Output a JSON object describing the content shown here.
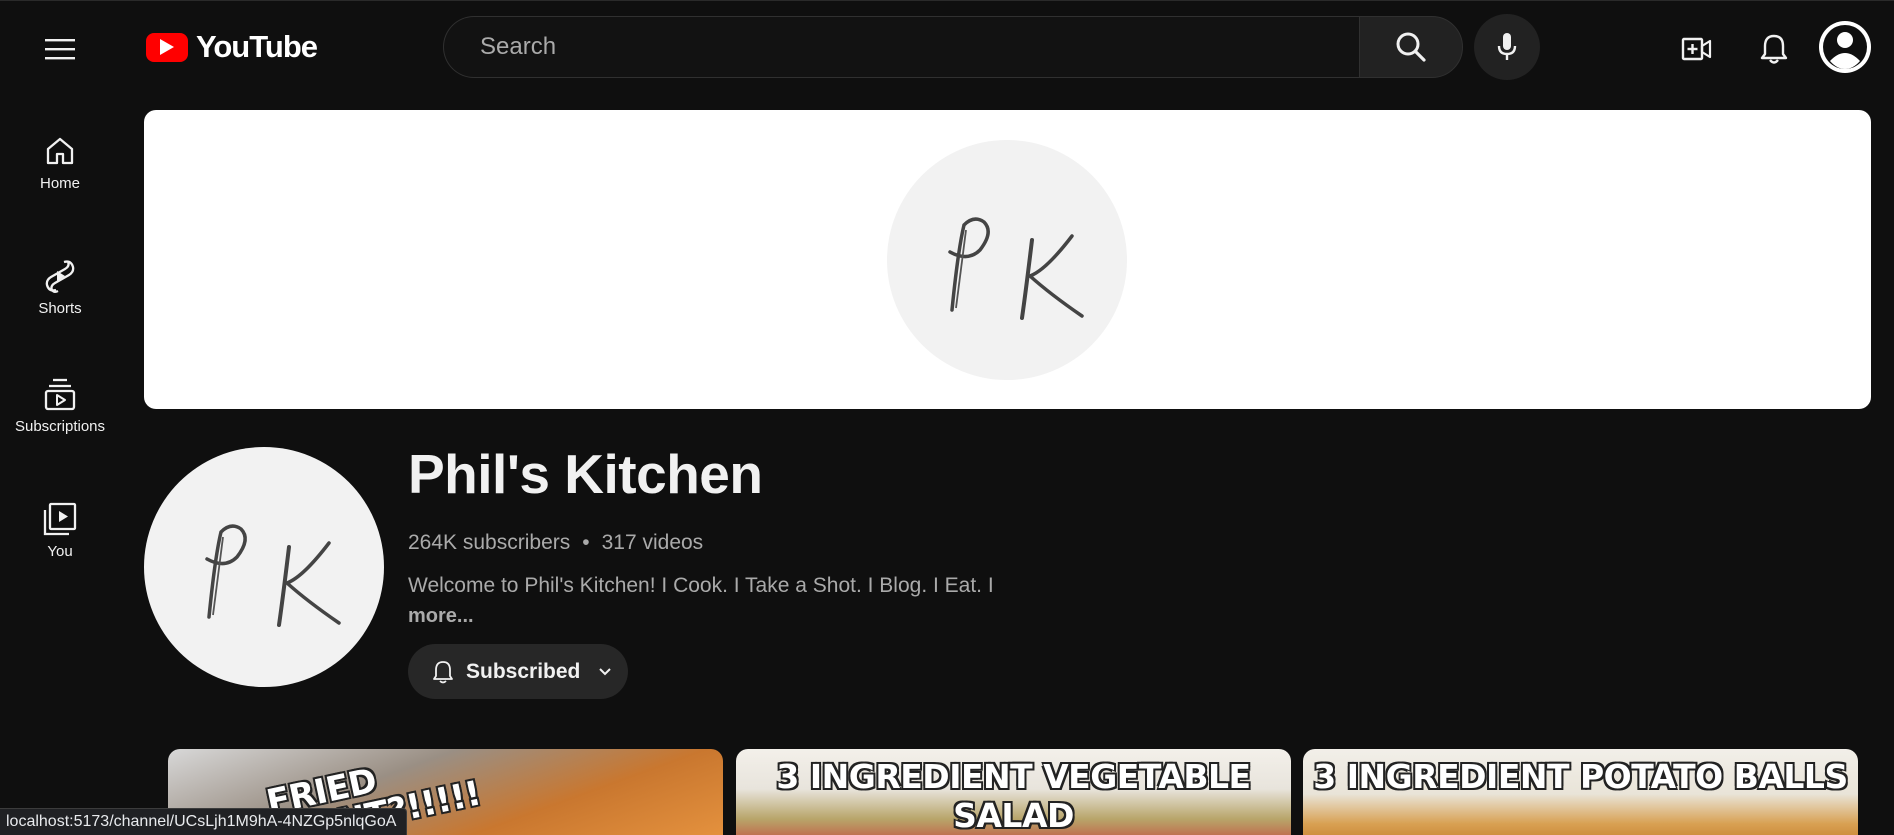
{
  "header": {
    "logo_text": "YouTube",
    "search_placeholder": "Search"
  },
  "sidebar": {
    "items": [
      {
        "label": "Home",
        "icon": "home-icon"
      },
      {
        "label": "Shorts",
        "icon": "shorts-icon"
      },
      {
        "label": "Subscriptions",
        "icon": "subscriptions-icon"
      },
      {
        "label": "You",
        "icon": "you-icon"
      }
    ]
  },
  "channel": {
    "name": "Phil's Kitchen",
    "subscribers": "264K subscribers",
    "separator": "•",
    "videos": "317 videos",
    "description": "Welcome to Phil's Kitchen! I Cook. I Take a Shot. I Blog. I Eat. I",
    "more_label": "more...",
    "subscribe_label": "Subscribed",
    "logo_monogram": "PK"
  },
  "videos": [
    {
      "thumb_text": "FRIED GIANT?!!!!!"
    },
    {
      "thumb_text": "3 INGREDIENT VEGETABLE SALAD"
    },
    {
      "thumb_text": "3 INGREDIENT POTATO BALLS"
    }
  ],
  "status_bar": {
    "url": "localhost:5173/channel/UCsLjh1M9hA-4NZGp5nlqGoA"
  },
  "colors": {
    "background": "#0f0f0f",
    "brand_red": "#ff0000",
    "button_bg": "#272727",
    "secondary_text": "#aaaaaa"
  }
}
